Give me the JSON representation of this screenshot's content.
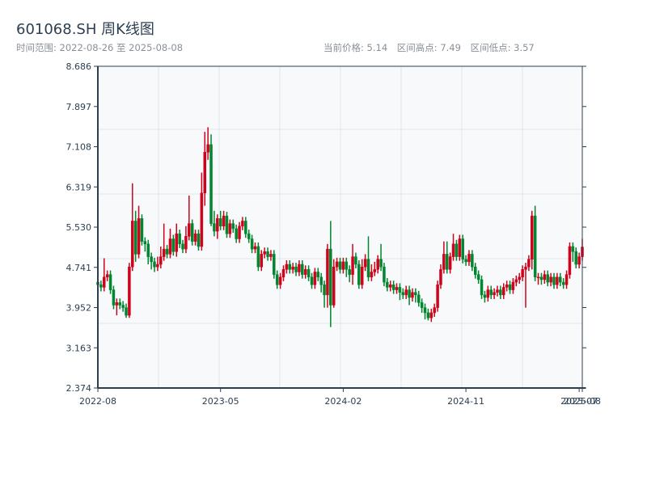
{
  "header": {
    "title": "601068.SH 周K线图",
    "range_label": "时间范围: 2022-08-26 至 2025-08-08",
    "current_price": "当前价格: 5.14",
    "range_high": "区间高点: 7.49",
    "range_low": "区间低点: 3.57"
  },
  "chart_data": {
    "type": "candlestick",
    "title": "601068.SH 周K线图",
    "start_date": "2022-08-26",
    "end_date": "2025-08-08",
    "interval": "week",
    "colors": {
      "up": "#d0021b",
      "down": "#00862f",
      "plot_bg": "#f7f9fb",
      "grid": "#e3e6eb",
      "axis": "#2c3e50"
    },
    "grid": true,
    "ylim": [
      2.374,
      8.686
    ],
    "y_ticks": [
      "8.686",
      "7.897",
      "7.108",
      "6.319",
      "5.530",
      "4.741",
      "3.952",
      "3.163",
      "2.374"
    ],
    "x_ticks": [
      {
        "label": "2022-08",
        "date": "2022-08-26"
      },
      {
        "label": "2023-05",
        "date": "2023-05-26"
      },
      {
        "label": "2024-02",
        "date": "2024-02-23"
      },
      {
        "label": "2024-11",
        "date": "2024-11-22"
      },
      {
        "label": "2025-07",
        "date": "2025-08-01"
      },
      {
        "label": "2025-08",
        "date": "2025-08-08"
      }
    ],
    "ohlc_fields": [
      "open",
      "high",
      "low",
      "close"
    ],
    "ohlc": [
      [
        4.45,
        4.53,
        4.32,
        4.4
      ],
      [
        4.4,
        4.48,
        4.27,
        4.35
      ],
      [
        4.35,
        4.92,
        4.27,
        4.55
      ],
      [
        4.55,
        4.68,
        4.47,
        4.6
      ],
      [
        4.6,
        4.68,
        4.22,
        4.3
      ],
      [
        4.3,
        4.38,
        3.92,
        4.0
      ],
      [
        4.0,
        4.13,
        3.8,
        4.05
      ],
      [
        4.05,
        4.13,
        3.92,
        4.0
      ],
      [
        4.0,
        4.08,
        3.87,
        3.95
      ],
      [
        3.95,
        4.03,
        3.75,
        3.8
      ],
      [
        3.8,
        4.83,
        3.75,
        4.75
      ],
      [
        4.75,
        6.39,
        4.67,
        5.65
      ],
      [
        5.65,
        5.85,
        4.85,
        5.0
      ],
      [
        5.0,
        5.95,
        4.92,
        5.7
      ],
      [
        5.7,
        5.78,
        5.17,
        5.25
      ],
      [
        5.25,
        5.33,
        5.05,
        5.2
      ],
      [
        5.2,
        5.28,
        4.8,
        4.95
      ],
      [
        4.95,
        5.03,
        4.7,
        4.85
      ],
      [
        4.85,
        4.93,
        4.65,
        4.75
      ],
      [
        4.75,
        4.95,
        4.67,
        4.8
      ],
      [
        4.8,
        5.15,
        4.72,
        4.95
      ],
      [
        4.95,
        5.6,
        4.87,
        5.1
      ],
      [
        5.1,
        5.18,
        4.92,
        5.0
      ],
      [
        5.0,
        5.5,
        4.92,
        5.3
      ],
      [
        5.3,
        5.38,
        4.97,
        5.05
      ],
      [
        5.05,
        5.6,
        4.95,
        5.4
      ],
      [
        5.4,
        5.48,
        5.12,
        5.2
      ],
      [
        5.2,
        5.28,
        5.02,
        5.1
      ],
      [
        5.1,
        5.55,
        5.02,
        5.35
      ],
      [
        5.35,
        6.15,
        5.27,
        5.6
      ],
      [
        5.6,
        5.68,
        5.17,
        5.25
      ],
      [
        5.25,
        5.48,
        5.17,
        5.4
      ],
      [
        5.4,
        5.48,
        5.07,
        5.15
      ],
      [
        5.15,
        6.6,
        5.07,
        6.2
      ],
      [
        6.2,
        7.4,
        5.95,
        7.0
      ],
      [
        7.0,
        7.49,
        6.85,
        7.15
      ],
      [
        7.15,
        7.35,
        5.55,
        5.6
      ],
      [
        5.6,
        5.85,
        5.35,
        5.45
      ],
      [
        5.45,
        5.78,
        5.3,
        5.7
      ],
      [
        5.7,
        5.85,
        5.47,
        5.55
      ],
      [
        5.55,
        5.85,
        5.47,
        5.75
      ],
      [
        5.75,
        5.83,
        5.32,
        5.4
      ],
      [
        5.4,
        5.68,
        5.32,
        5.6
      ],
      [
        5.6,
        5.68,
        5.42,
        5.5
      ],
      [
        5.5,
        5.58,
        5.22,
        5.3
      ],
      [
        5.3,
        5.63,
        5.22,
        5.55
      ],
      [
        5.55,
        5.73,
        5.47,
        5.65
      ],
      [
        5.65,
        5.73,
        5.32,
        5.4
      ],
      [
        5.4,
        5.48,
        5.22,
        5.3
      ],
      [
        5.3,
        5.38,
        5.02,
        5.1
      ],
      [
        5.1,
        5.23,
        5.02,
        5.15
      ],
      [
        5.15,
        5.23,
        4.67,
        4.75
      ],
      [
        4.75,
        5.08,
        4.67,
        5.0
      ],
      [
        5.0,
        5.13,
        4.92,
        5.05
      ],
      [
        5.05,
        5.13,
        4.87,
        4.95
      ],
      [
        4.95,
        5.08,
        4.87,
        5.0
      ],
      [
        5.0,
        5.08,
        4.52,
        4.6
      ],
      [
        4.6,
        4.68,
        4.32,
        4.4
      ],
      [
        4.4,
        4.63,
        4.32,
        4.55
      ],
      [
        4.55,
        4.78,
        4.47,
        4.7
      ],
      [
        4.7,
        4.88,
        4.62,
        4.8
      ],
      [
        4.8,
        4.88,
        4.62,
        4.7
      ],
      [
        4.7,
        4.83,
        4.62,
        4.75
      ],
      [
        4.75,
        4.83,
        4.57,
        4.65
      ],
      [
        4.65,
        4.88,
        4.57,
        4.8
      ],
      [
        4.8,
        4.88,
        4.52,
        4.6
      ],
      [
        4.6,
        4.78,
        4.52,
        4.7
      ],
      [
        4.7,
        4.78,
        4.47,
        4.55
      ],
      [
        4.55,
        4.63,
        4.32,
        4.4
      ],
      [
        4.4,
        4.73,
        4.32,
        4.65
      ],
      [
        4.65,
        4.73,
        4.47,
        4.55
      ],
      [
        4.55,
        4.63,
        4.25,
        4.4
      ],
      [
        4.4,
        4.48,
        3.95,
        4.2
      ],
      [
        4.2,
        5.2,
        3.95,
        5.1
      ],
      [
        5.1,
        5.65,
        3.57,
        4.0
      ],
      [
        4.0,
        4.9,
        3.95,
        4.75
      ],
      [
        4.75,
        4.93,
        4.67,
        4.85
      ],
      [
        4.85,
        4.93,
        4.62,
        4.7
      ],
      [
        4.7,
        4.93,
        4.62,
        4.85
      ],
      [
        4.85,
        4.93,
        4.55,
        4.7
      ],
      [
        4.7,
        4.78,
        4.45,
        4.6
      ],
      [
        4.6,
        5.2,
        4.4,
        4.95
      ],
      [
        4.95,
        5.03,
        4.72,
        4.8
      ],
      [
        4.8,
        4.88,
        4.32,
        4.4
      ],
      [
        4.4,
        4.9,
        4.32,
        4.75
      ],
      [
        4.75,
        5.0,
        4.67,
        4.9
      ],
      [
        4.9,
        5.35,
        4.47,
        4.55
      ],
      [
        4.55,
        4.8,
        4.47,
        4.65
      ],
      [
        4.65,
        4.85,
        4.57,
        4.7
      ],
      [
        4.7,
        4.98,
        4.62,
        4.9
      ],
      [
        4.9,
        5.2,
        4.67,
        4.75
      ],
      [
        4.75,
        4.83,
        4.37,
        4.45
      ],
      [
        4.45,
        4.53,
        4.27,
        4.35
      ],
      [
        4.35,
        4.48,
        4.27,
        4.4
      ],
      [
        4.4,
        4.48,
        4.22,
        4.3
      ],
      [
        4.3,
        4.43,
        4.22,
        4.35
      ],
      [
        4.35,
        4.43,
        4.1,
        4.25
      ],
      [
        4.25,
        4.33,
        4.12,
        4.2
      ],
      [
        4.2,
        4.38,
        4.12,
        4.3
      ],
      [
        4.3,
        4.38,
        4.0,
        4.15
      ],
      [
        4.15,
        4.33,
        4.07,
        4.25
      ],
      [
        4.25,
        4.33,
        4.05,
        4.2
      ],
      [
        4.2,
        4.28,
        3.97,
        4.05
      ],
      [
        4.05,
        4.13,
        3.85,
        3.95
      ],
      [
        3.95,
        4.03,
        3.72,
        3.85
      ],
      [
        3.85,
        3.93,
        3.7,
        3.75
      ],
      [
        3.75,
        3.93,
        3.67,
        3.85
      ],
      [
        3.85,
        4.03,
        3.77,
        3.95
      ],
      [
        3.95,
        4.48,
        3.87,
        4.4
      ],
      [
        4.4,
        4.8,
        4.32,
        4.7
      ],
      [
        4.7,
        5.25,
        4.62,
        5.0
      ],
      [
        5.0,
        5.25,
        4.62,
        4.7
      ],
      [
        4.7,
        5.03,
        4.62,
        4.95
      ],
      [
        4.95,
        5.4,
        4.87,
        5.2
      ],
      [
        5.2,
        5.28,
        4.87,
        4.95
      ],
      [
        4.95,
        5.38,
        4.87,
        5.3
      ],
      [
        5.3,
        5.38,
        4.82,
        4.9
      ],
      [
        4.9,
        4.98,
        4.77,
        4.85
      ],
      [
        4.85,
        5.08,
        4.77,
        5.0
      ],
      [
        5.0,
        5.08,
        4.67,
        4.75
      ],
      [
        4.75,
        4.83,
        4.52,
        4.6
      ],
      [
        4.6,
        4.68,
        4.42,
        4.5
      ],
      [
        4.5,
        4.58,
        4.12,
        4.2
      ],
      [
        4.2,
        4.28,
        4.05,
        4.15
      ],
      [
        4.15,
        4.38,
        4.07,
        4.3
      ],
      [
        4.3,
        4.38,
        4.12,
        4.2
      ],
      [
        4.2,
        4.33,
        4.12,
        4.25
      ],
      [
        4.25,
        4.38,
        4.17,
        4.3
      ],
      [
        4.3,
        4.38,
        4.12,
        4.2
      ],
      [
        4.2,
        4.43,
        4.12,
        4.35
      ],
      [
        4.35,
        4.48,
        4.27,
        4.4
      ],
      [
        4.4,
        4.48,
        4.22,
        4.3
      ],
      [
        4.3,
        4.53,
        4.22,
        4.45
      ],
      [
        4.45,
        4.58,
        4.37,
        4.5
      ],
      [
        4.5,
        4.63,
        4.42,
        4.55
      ],
      [
        4.55,
        4.78,
        4.47,
        4.7
      ],
      [
        4.7,
        4.83,
        3.95,
        4.75
      ],
      [
        4.75,
        4.98,
        4.67,
        4.9
      ],
      [
        4.9,
        5.85,
        4.7,
        5.75
      ],
      [
        5.75,
        5.95,
        4.47,
        4.55
      ],
      [
        4.55,
        4.63,
        4.4,
        4.55
      ],
      [
        4.55,
        4.63,
        4.4,
        4.5
      ],
      [
        4.5,
        4.68,
        4.42,
        4.6
      ],
      [
        4.6,
        4.68,
        4.37,
        4.45
      ],
      [
        4.45,
        4.63,
        4.37,
        4.55
      ],
      [
        4.55,
        4.63,
        4.32,
        4.4
      ],
      [
        4.4,
        4.63,
        4.32,
        4.55
      ],
      [
        4.55,
        4.63,
        4.37,
        4.45
      ],
      [
        4.45,
        4.53,
        4.32,
        4.4
      ],
      [
        4.4,
        4.68,
        4.32,
        4.6
      ],
      [
        4.6,
        5.23,
        4.52,
        5.15
      ],
      [
        5.15,
        5.23,
        4.85,
        5.05
      ],
      [
        5.05,
        5.13,
        4.72,
        4.8
      ],
      [
        4.8,
        5.03,
        4.72,
        4.95
      ],
      [
        4.95,
        5.3,
        4.87,
        5.14
      ]
    ]
  }
}
